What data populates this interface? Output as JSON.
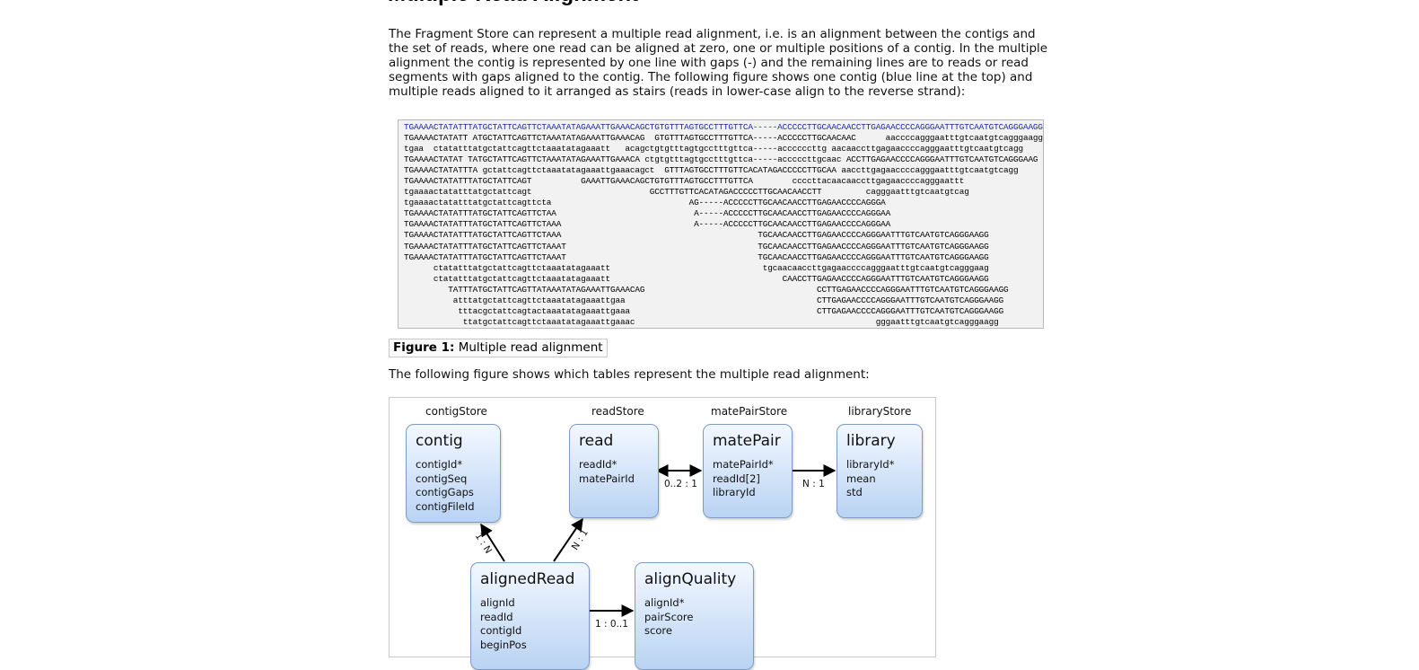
{
  "heading": "Multiple Read Alignment",
  "intro": "The Fragment Store can represent a multiple read alignment, i.e. is an alignment between the contigs and the set of reads, where one read can be aligned at zero, one or multiple positions of a contig. In the multiple alignment the contig is represented by one line with gaps (-) and the remaining lines are to reads or read segments with gaps aligned to the contig. The following figure shows one contig (blue line at the top) and multiple reads aligned to it arranged as stairs (reads in lower-case align to the reverse strand):",
  "alignment": {
    "contig_line": "TGAAAACTATATTTATGCTATTCAGTTCTAAATATAGAAATTGAAACAGCTGTGTTTAGTGCCTTTGTTCA-----ACCCCCTTGCAACAACCTTGAGAACCCCAGGGAATTTGTCAATGTCAGGGAAGGAGCATTTTGTCAGTTACCAAATGTGTTTATTACCAGAGGGATGGAGGGAAGAGGGACGCTGAAGAACTTTGATGCCCTCTTCTTCCAAAGATGAAACGCGTAACTGCGCTCTCATTCACTCCAGCTCCCTGTCACCCAATGGACCTGTGATATCTGGATTCTGGGATTCTTTACTTCCCATGGAAATGCATCAGCATCACCAGAGTTATTAGGGAATGCTGAGGGAGAAATGCCTTTCAAGAGCAGCTGAGGGCTACGATAAACTCTAGTGAAGCTCTCTCATCCTTCAGAAAGGAGCC",
    "read_lines": [
      "TGAAAACTATATT ATGCTATTCAGTTCTAAATATAGAAATTGAAACAG  GTGTTTAGTGCCTTTGTTCA-----ACCCCCTTGCAACAAC      aaccccagggaatttgtcaatgtcagggaaggagcatt",
      "tgaa  ctatatttatgctattcagttctaaatatagaaatt   acagctgtgtttagtgcctttgttca-----accccccttg aacaaccttgagaaccccagggaatttgtcaatgtcagg",
      "TGAAAACTATAT TATGCTATTCAGTTCTAAATATAGAAATTGAAACA ctgtgtttagtgcctttgttca-----acccccttgcaac ACCTTGAGAACCCCAGGGAATTTGTCAATGTCAGGGAAG",
      "TGAAAACTATATTTA gctattcagttctaaatatagaaattgaaacagct  GTTTAGTGCCTTTGTTCACATAGACCCCCTTGCAA aaccttgagaaccccagggaatttgtcaatgtcagg",
      "TGAAAACTATATTTATGCTATTCAGT          GAAATTGAAACAGCTGTGTTTAGTGCCTTTGTTCA        ccccttacaacaaccttgagaaccccagggaattt",
      "tgaaaactatatttatgctattcagt                        GCCTTTGTTCACATAGACCCCCTTGCAACAACCTT         cagggaatttgtcaatgtcag",
      "tgaaaactatatttatgctattcagttcta                            AG-----ACCCCCTTGCAACAACCTTGAGAACCCCAGGGA",
      "TGAAAACTATATTTATGCTATTCAGTTCTAA                            A-----ACCCCCTTGCAACAACCTTGAGAACCCCAGGGAA",
      "TGAAAACTATATTTATGCTATTCAGTTCTAAA                           A-----ACCCCCTTGCAACAACCTTGAGAACCCCAGGGAA",
      "TGAAAACTATATTTATGCTATTCAGTTCTAAA                                        TGCAACAACCTTGAGAACCCCAGGGAATTTGTCAATGTCAGGGAAGG",
      "TGAAAACTATATTTATGCTATTCAGTTCTAAAT                                       TGCAACAACCTTGAGAACCCCAGGGAATTTGTCAATGTCAGGGAAGG",
      "TGAAAACTATATTTATGCTATTCAGTTCTAAAT                                       TGCAACAACCTTGAGAACCCCAGGGAATTTGTCAATGTCAGGGAAGG",
      "      ctatatttatgctattcagttctaaatatagaaatt                               tgcaacaaccttgagaaccccagggaatttgtcaatgtcagggaag",
      "      ctatatttatgctattcagttctaaatatagaaatt                                   CAACCTTGAGAACCCCAGGGAATTTGTCAATGTCAGGGAAGG",
      "         TATTTATGCTATTCAGTTATAAATATAGAAATTGAAACAG                                   CCTTGAGAACCCCAGGGAATTTGTCAATGTCAGGGAAGG",
      "          atttatgctattcagttctaaatatagaaattgaa                                       CTTGAGAACCCCAGGGAATTTGTCAATGTCAGGGAAGG",
      "           tttacgctattcagtactaaatatagaaattgaaa                                      CTTGAGAACCCCAGGGAATTTGTCAATGTCAGGGAAGG",
      "            ttatgctattcagttctaaatatagaaattgaaac                                                 gggaatttgtcaatgtcagggaagg"
    ]
  },
  "caption": {
    "label": "Figure 1:",
    "text": " Multiple read alignment"
  },
  "followup": "The following figure shows which tables represent the multiple read alignment:",
  "diagram": {
    "stores": {
      "contig": "contigStore",
      "read": "readStore",
      "matepair": "matePairStore",
      "library": "libraryStore"
    },
    "entities": {
      "contig": {
        "title": "contig",
        "fields": [
          "contigId*",
          "contigSeq",
          "contigGaps",
          "contigFileId"
        ]
      },
      "read": {
        "title": "read",
        "fields": [
          "readId*",
          "matePairId"
        ]
      },
      "matepair": {
        "title": "matePair",
        "fields": [
          "matePairId*",
          "readId[2]",
          "libraryId"
        ]
      },
      "library": {
        "title": "library",
        "fields": [
          "libraryId*",
          "mean",
          "std"
        ]
      },
      "alignedread": {
        "title": "alignedRead",
        "fields": [
          "alignId",
          "readId",
          "contigId",
          "beginPos"
        ]
      },
      "alignquality": {
        "title": "alignQuality",
        "fields": [
          "alignId*",
          "pairScore",
          "score"
        ]
      }
    },
    "relations": {
      "read_matepair": "0..2 : 1",
      "matepair_library": "N : 1",
      "aligned_contig": "1 : N",
      "aligned_read": "N : 1",
      "aligned_quality": "1 : 0..1"
    }
  },
  "colors": {
    "contig_line": "#1a2aa8",
    "entity_border": "#7d9cc4",
    "entity_fill_top": "#f3f8ff",
    "entity_fill_bottom": "#b9d3f3"
  }
}
